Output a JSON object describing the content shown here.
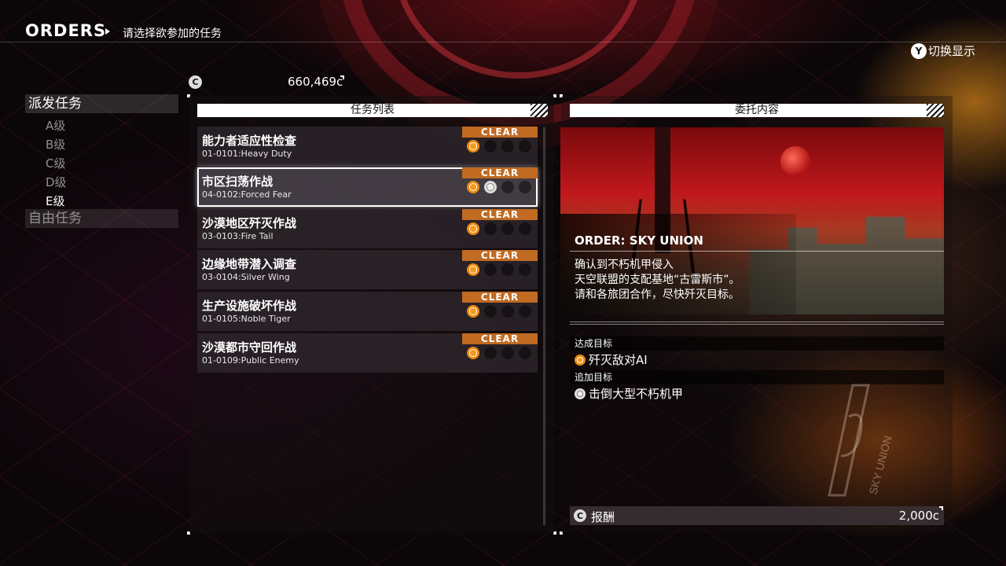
{
  "header": {
    "title": "ORDERS",
    "subtitle": "请选择欲参加的任务",
    "toggle_button": "Y",
    "toggle_label": "切换显示"
  },
  "sidebar": {
    "category_dispatch": "派发任务",
    "ranks": [
      "A级",
      "B级",
      "C级",
      "D级",
      "E级"
    ],
    "active_rank": "E级",
    "category_free": "自由任务"
  },
  "credits": {
    "icon": "credit-icon",
    "symbol": "C",
    "value": "660,469c"
  },
  "mission_list": {
    "header": "任务列表",
    "missions": [
      {
        "title": "能力者适应性检查",
        "code": "01-0101:Heavy Duty",
        "badge": "CLEAR",
        "medals": [
          "gold",
          "empty",
          "empty",
          "empty"
        ]
      },
      {
        "title": "市区扫荡作战",
        "code": "04-0102:Forced Fear",
        "badge": "CLEAR",
        "medals": [
          "gold",
          "silver",
          "empty",
          "empty"
        ],
        "selected": true
      },
      {
        "title": "沙漠地区歼灭作战",
        "code": "03-0103:Fire Tail",
        "badge": "CLEAR",
        "medals": [
          "gold",
          "empty",
          "empty",
          "empty"
        ]
      },
      {
        "title": "边缘地带潜入调查",
        "code": "03-0104:Silver Wing",
        "badge": "CLEAR",
        "medals": [
          "gold",
          "empty",
          "empty",
          "empty"
        ]
      },
      {
        "title": "生产设施破坏作战",
        "code": "01-0105:Noble Tiger",
        "badge": "CLEAR",
        "medals": [
          "gold",
          "empty",
          "empty",
          "empty"
        ]
      },
      {
        "title": "沙漠都市守回作战",
        "code": "01-0109:Public Enemy",
        "badge": "CLEAR",
        "medals": [
          "gold",
          "empty",
          "empty",
          "empty"
        ]
      }
    ]
  },
  "detail": {
    "header": "委托内容",
    "order_title": "ORDER: SKY UNION",
    "description": [
      "确认到不朽机甲侵入",
      "天空联盟的支配基地“古雷斯市”。",
      "请和各旅团合作，尽快歼灭目标。"
    ],
    "objective_header": "达成目标",
    "objective": "歼灭敌对AI",
    "bonus_header": "追加目标",
    "bonus": "击倒大型不朽机甲",
    "reward_label": "报酬",
    "reward_value": "2,000c",
    "emblem_text": "SKY UNION"
  },
  "colors": {
    "clear_badge": "#c06a22",
    "gold_medal": "#f39a1c",
    "silver_medal": "#dddddd",
    "accent_red": "#c0181c"
  }
}
